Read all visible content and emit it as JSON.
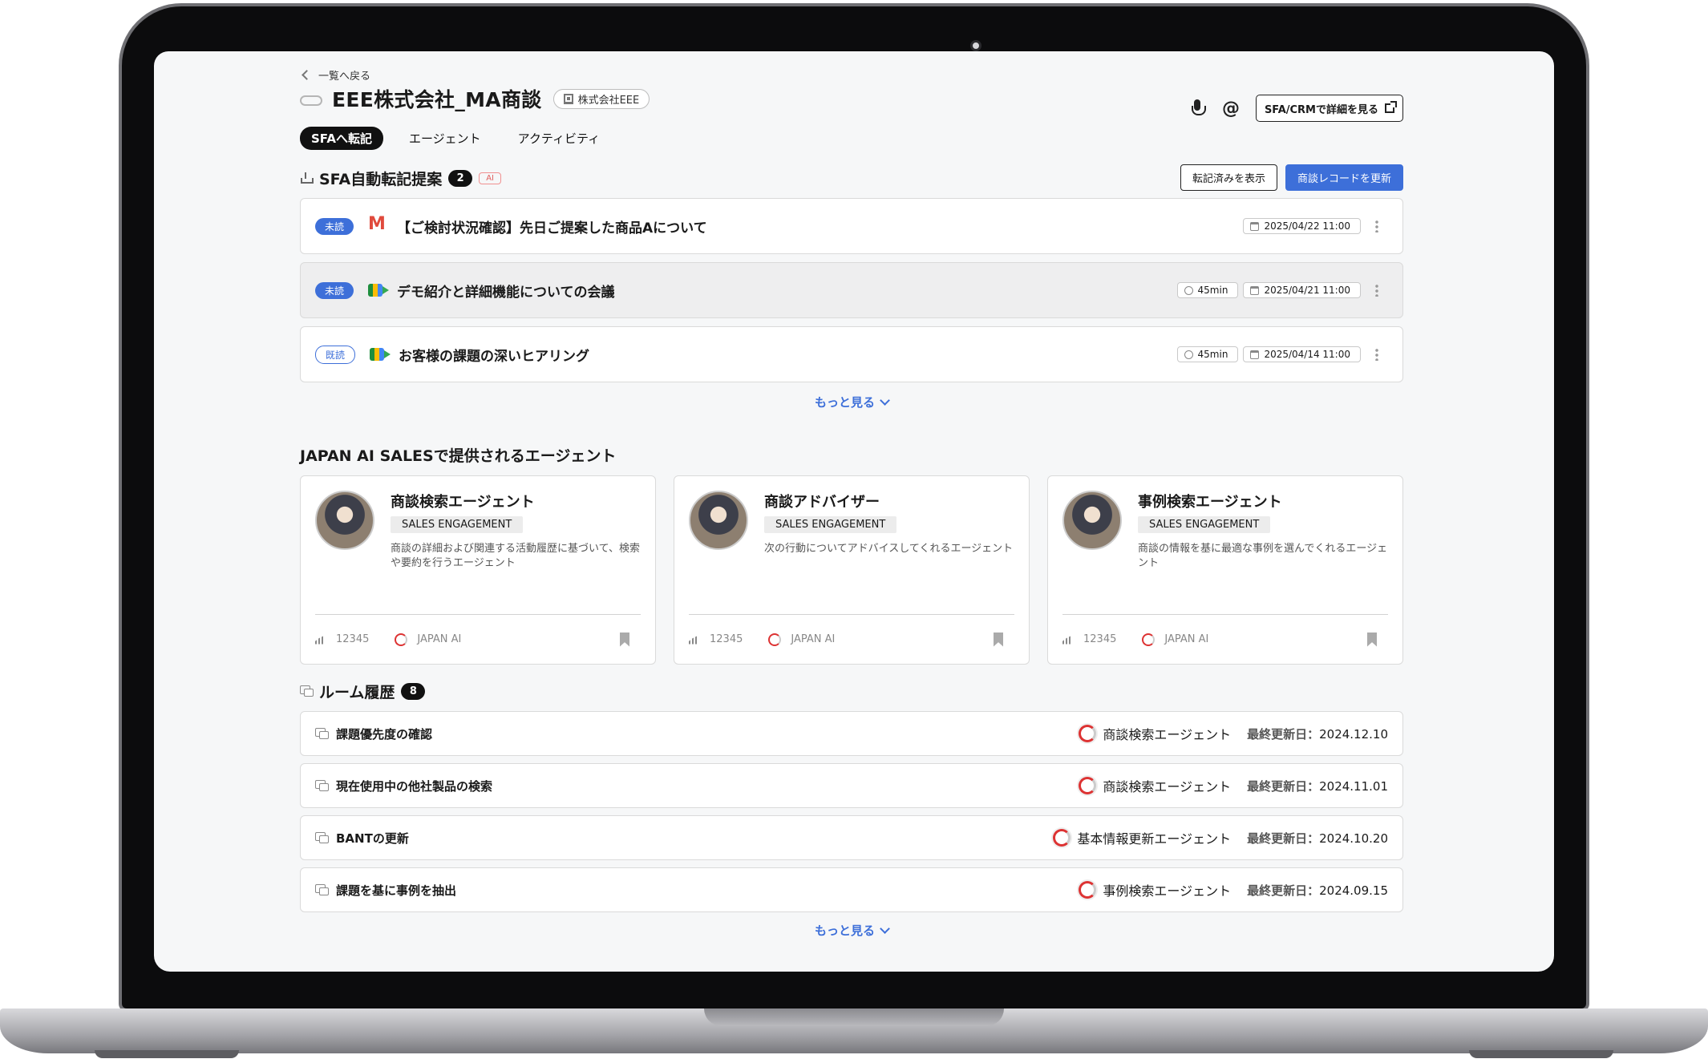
{
  "header": {
    "back_label": "一覧へ戻る",
    "title": "EEE株式会社_MA商談",
    "company_chip": "株式会社EEE",
    "sfa_button": "SFA/CRMで詳細を見る"
  },
  "tabs": [
    {
      "label": "SFAへ転記",
      "active": true
    },
    {
      "label": "エージェント",
      "active": false
    },
    {
      "label": "アクティビティ",
      "active": false
    }
  ],
  "transcription": {
    "title": "SFA自動転記提案",
    "count": "2",
    "ai_badge": "AI",
    "show_transcribed": "転記済みを表示",
    "update_record": "商談レコードを更新",
    "items": [
      {
        "status": "未読",
        "service": "gmail-icon",
        "title": "【ご検討状況確認】先日ご提案した商品Aについて",
        "duration": "",
        "date": "2025/04/22 11:00"
      },
      {
        "status": "未読",
        "service": "meet-icon",
        "title": "デモ紹介と詳細機能についての会議",
        "duration": "45min",
        "date": "2025/04/21 11:00"
      },
      {
        "status": "既読",
        "service": "meet-icon",
        "title": "お客様の課題の深いヒアリング",
        "duration": "45min",
        "date": "2025/04/14 11:00"
      }
    ],
    "more": "もっと見る"
  },
  "agents": {
    "title": "JAPAN AI SALESで提供されるエージェント",
    "cards": [
      {
        "name": "商談検索エージェント",
        "tag": "SALES ENGAGEMENT",
        "desc": "商談の詳細および関連する活動履歴に基づいて、検索や要約を行うエージェント",
        "count": "12345",
        "vendor": "JAPAN AI"
      },
      {
        "name": "商談アドバイザー",
        "tag": "SALES ENGAGEMENT",
        "desc": "次の行動についてアドバイスしてくれるエージェント",
        "count": "12345",
        "vendor": "JAPAN AI"
      },
      {
        "name": "事例検索エージェント",
        "tag": "SALES ENGAGEMENT",
        "desc": "商談の情報を基に最適な事例を選んでくれるエージェント",
        "count": "12345",
        "vendor": "JAPAN AI"
      }
    ]
  },
  "rooms": {
    "title": "ルーム履歴",
    "count": "8",
    "updated_label": "最終更新日：",
    "items": [
      {
        "title": "課題優先度の確認",
        "agent": "商談検索エージェント",
        "date": "2024.12.10"
      },
      {
        "title": "現在使用中の他社製品の検索",
        "agent": "商談検索エージェント",
        "date": "2024.11.01"
      },
      {
        "title": "BANTの更新",
        "agent": "基本情報更新エージェント",
        "date": "2024.10.20"
      },
      {
        "title": "課題を基に事例を抽出",
        "agent": "事例検索エージェント",
        "date": "2024.09.15"
      }
    ],
    "more": "もっと見る"
  },
  "colors": {
    "accent": "#3d6fd9",
    "badge_dark": "#111111",
    "ai_badge": "#e06060"
  }
}
